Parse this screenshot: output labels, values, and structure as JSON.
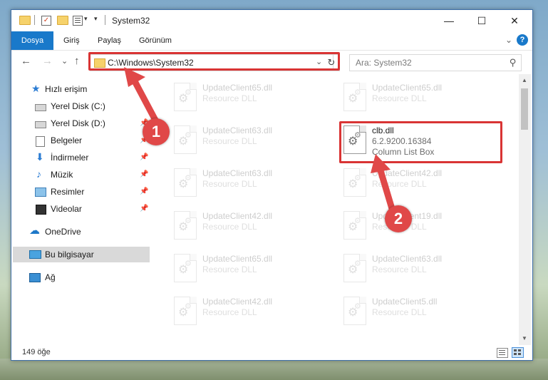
{
  "colors": {
    "accent": "#1979ca",
    "highlight_red": "#d93434",
    "badge_red": "#e04848",
    "selected_bg": "#d9d9d9"
  },
  "window": {
    "title": "System32",
    "controls": {
      "minimize": "—",
      "maximize": "☐",
      "close": "✕"
    }
  },
  "ribbon": {
    "tabs": [
      "Dosya",
      "Giriş",
      "Paylaş",
      "Görünüm"
    ],
    "help_label": "?"
  },
  "nav": {
    "back_icon": "←",
    "forward_icon": "→",
    "recent_icon": "⌄",
    "up_icon": "↑",
    "address_path": "C:\\Windows\\System32",
    "address_dropdown_icon": "⌄",
    "refresh_icon": "↻",
    "search_placeholder": "Ara: System32",
    "search_icon": "⚲"
  },
  "sidebar": {
    "items": [
      {
        "label": "Hızlı erişim",
        "icon": "star-icon"
      },
      {
        "label": "Yerel Disk (C:)",
        "icon": "drive-icon"
      },
      {
        "label": "Yerel Disk (D:)",
        "icon": "drive-icon",
        "pinned": true
      },
      {
        "label": "Belgeler",
        "icon": "documents-icon",
        "pinned": true
      },
      {
        "label": "İndirmeler",
        "icon": "download-icon",
        "pinned": true
      },
      {
        "label": "Müzik",
        "icon": "music-icon",
        "pinned": true
      },
      {
        "label": "Resimler",
        "icon": "pictures-icon",
        "pinned": true
      },
      {
        "label": "Videolar",
        "icon": "videos-icon",
        "pinned": true
      },
      {
        "label": "OneDrive",
        "icon": "onedrive-icon"
      },
      {
        "label": "Bu bilgisayar",
        "icon": "this-pc-icon",
        "selected": true
      },
      {
        "label": "Ağ",
        "icon": "network-icon"
      }
    ],
    "pin_glyph": "📌"
  },
  "files": {
    "left_column": [
      {
        "name": "UpdateClient65.dll",
        "type": "Resource DLL"
      },
      {
        "name": "UpdateClient63.dll",
        "type": "Resource DLL"
      },
      {
        "name": "UpdateClient63.dll",
        "type": "Resource DLL"
      },
      {
        "name": "UpdateClient42.dll",
        "type": "Resource DLL"
      },
      {
        "name": "UpdateClient65.dll",
        "type": "Resource DLL"
      },
      {
        "name": "UpdateClient42.dll",
        "type": "Resource DLL"
      }
    ],
    "right_column": [
      {
        "name": "UpdateClient65.dll",
        "type": "Resource DLL"
      },
      {
        "name": "clb.dll",
        "version": "6.2.9200.16384",
        "type": "Column List Box",
        "highlighted": true
      },
      {
        "name": "UpdateClient42.dll",
        "type": "Resource DLL"
      },
      {
        "name": "UpdateClient19.dll",
        "type": "Resource DLL"
      },
      {
        "name": "UpdateClient63.dll",
        "type": "Resource DLL"
      },
      {
        "name": "UpdateClient5.dll",
        "type": "Resource DLL"
      }
    ]
  },
  "status": {
    "item_count": "149 öğe"
  },
  "annotations": {
    "step1": "1",
    "step2": "2"
  }
}
